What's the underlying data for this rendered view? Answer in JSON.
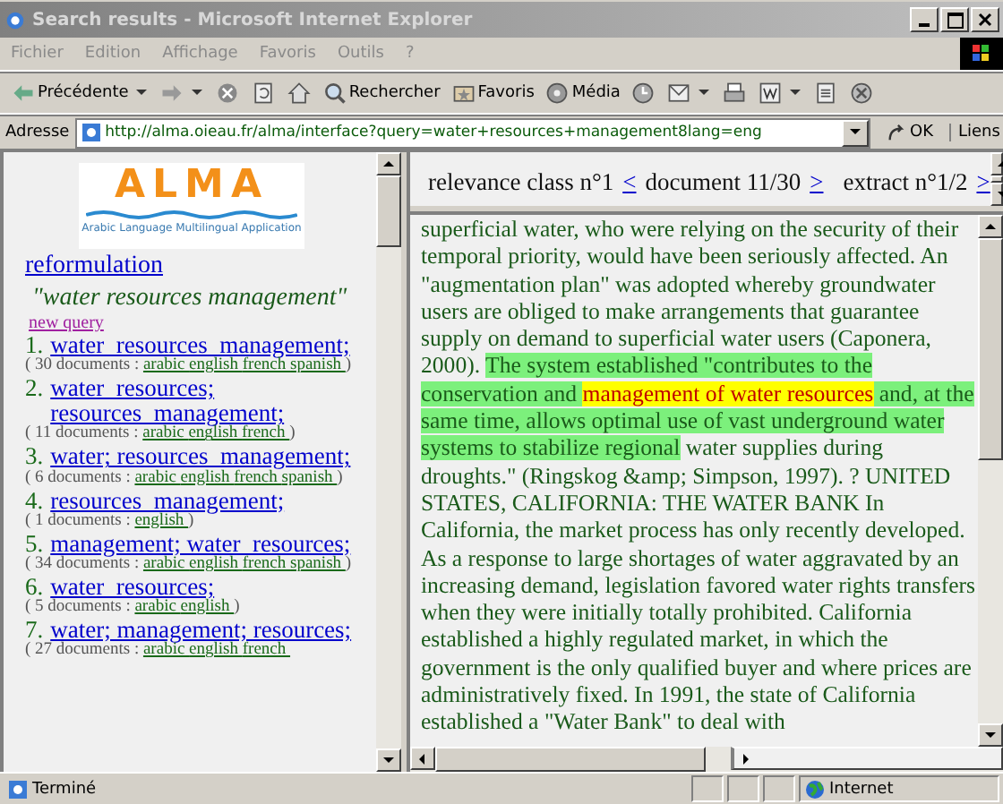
{
  "window": {
    "title": "Search results - Microsoft Internet Explorer"
  },
  "menu": [
    "Fichier",
    "Edition",
    "Affichage",
    "Favoris",
    "Outils",
    "?"
  ],
  "toolbar": [
    {
      "kind": "back",
      "label": "Précédente",
      "dropdown": true
    },
    {
      "kind": "forward",
      "dropdown": true
    },
    {
      "kind": "stop",
      "dropdown": false
    },
    {
      "kind": "refresh",
      "dropdown": false
    },
    {
      "kind": "home",
      "dropdown": false
    },
    {
      "kind": "search",
      "label": "Rechercher",
      "dropdown": false
    },
    {
      "kind": "favorites",
      "label": "Favoris",
      "dropdown": false
    },
    {
      "kind": "media",
      "label": "Média",
      "dropdown": false
    },
    {
      "kind": "history",
      "dropdown": false
    },
    {
      "kind": "mail",
      "dropdown": true
    },
    {
      "kind": "print",
      "dropdown": false
    },
    {
      "kind": "edit",
      "dropdown": true
    },
    {
      "kind": "discuss",
      "dropdown": false
    },
    {
      "kind": "messenger",
      "dropdown": false
    }
  ],
  "address": {
    "label": "Adresse",
    "value": "http://alma.oieau.fr/alma/interface?query=water+resources+management8lang=eng",
    "go": "OK",
    "links": "Liens"
  },
  "logo": {
    "title": "ALMA",
    "subtitle": "Arabic Language Multilingual Application"
  },
  "reformulation": "reformulation",
  "query": "\"water resources management\"",
  "new_query": "new query",
  "results": [
    {
      "number": "1.",
      "terms": "water_resources_management;",
      "count": "( 30 documents :",
      "languages": [
        "arabic",
        "english",
        "french",
        "spanish"
      ],
      "close": ")"
    },
    {
      "number": "2.",
      "terms": "water_resources; resources_management;",
      "count": "( 11 documents :",
      "languages": [
        "arabic",
        "english",
        "french"
      ],
      "close": ")"
    },
    {
      "number": "3.",
      "terms": "water; resources_management;",
      "count": "( 6 documents :",
      "languages": [
        "arabic",
        "english",
        "french",
        "spanish"
      ],
      "close": ")"
    },
    {
      "number": "4.",
      "terms": "resources_management;",
      "count": "( 1 documents :",
      "languages": [
        "english"
      ],
      "close": ")"
    },
    {
      "number": "5.",
      "terms": "management; water_resources;",
      "count": "( 34 documents :",
      "languages": [
        "arabic",
        "english",
        "french",
        "spanish"
      ],
      "close": ")"
    },
    {
      "number": "6.",
      "terms": "water_resources;",
      "count": "( 5 documents :",
      "languages": [
        "arabic",
        "english"
      ],
      "close": ")"
    },
    {
      "number": "7.",
      "terms": "water; management; resources;",
      "count": "( 27 documents :",
      "languages": [
        "arabic",
        "english",
        "french"
      ]
    }
  ],
  "nav": {
    "relevance": "relevance class n°1",
    "prev_document": "<",
    "document": "document 11/30",
    "next_document": ">",
    "extract": "extract n°1/2",
    "next_extract": ">"
  },
  "passage": [
    {
      "kind": "plain",
      "text": "superficial water, who were relying on the security of their temporal priority, would have been seriously affected. An \"augmentation plan\" was adopted whereby groundwater users are obliged to make arrangements that guarantee supply on demand to superficial water users (Caponera, 2000). "
    },
    {
      "kind": "sentence",
      "text": "The system established \"contributes to the conservation and "
    },
    {
      "kind": "query",
      "text": "management of water resources"
    },
    {
      "kind": "sentence",
      "text": " and, at the same time, allows optimal use of vast underground water systems to stabilize regional"
    },
    {
      "kind": "plain",
      "text": " water supplies during droughts.\" (Ringskog &amp; Simpson, 1997). ? UNITED STATES, CALIFORNIA: THE WATER BANK In California, the market process has only recently developed. As a response to large shortages of water aggravated by an increasing demand, legislation favored water rights transfers when they were initially totally prohibited. California established a highly regulated market, in which the government is the only qualified buyer and where prices are administratively fixed. In 1991, the state of California established a \"Water Bank\" to deal with"
    }
  ],
  "status": {
    "text": "Terminé",
    "zone": "Internet"
  }
}
